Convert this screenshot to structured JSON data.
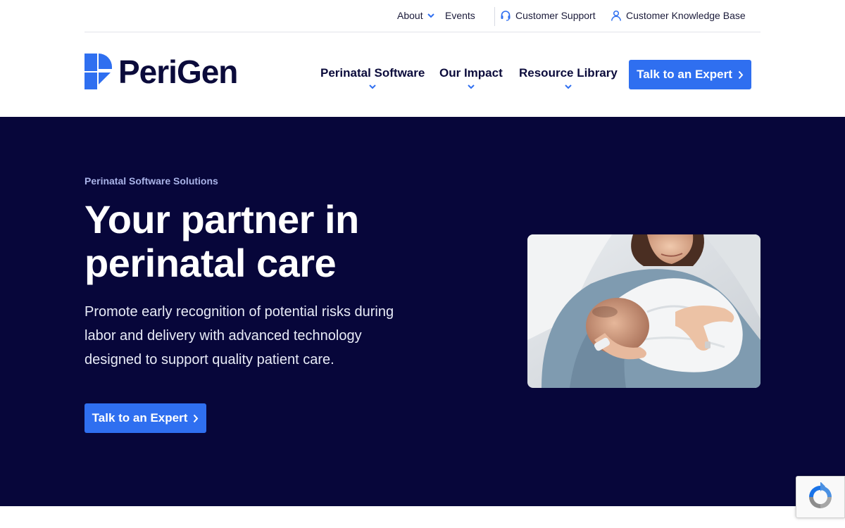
{
  "utility_nav": {
    "about": "About",
    "events": "Events",
    "support": "Customer Support",
    "knowledge_base": "Customer Knowledge Base"
  },
  "brand": {
    "name": "PeriGen"
  },
  "main_nav": {
    "items": [
      {
        "label": "Perinatal Software"
      },
      {
        "label": "Our Impact"
      },
      {
        "label": "Resource Library"
      }
    ],
    "cta": "Talk to an Expert"
  },
  "hero": {
    "eyebrow": "Perinatal Software Solutions",
    "title": "Your partner in perinatal care",
    "description": "Promote early recognition of potential risks during labor and delivery with advanced technology designed to support quality patient care.",
    "cta": "Talk to an Expert"
  },
  "colors": {
    "accent": "#2f6ff0",
    "navy": "#07063a",
    "text_dark": "#0b0b3b"
  }
}
